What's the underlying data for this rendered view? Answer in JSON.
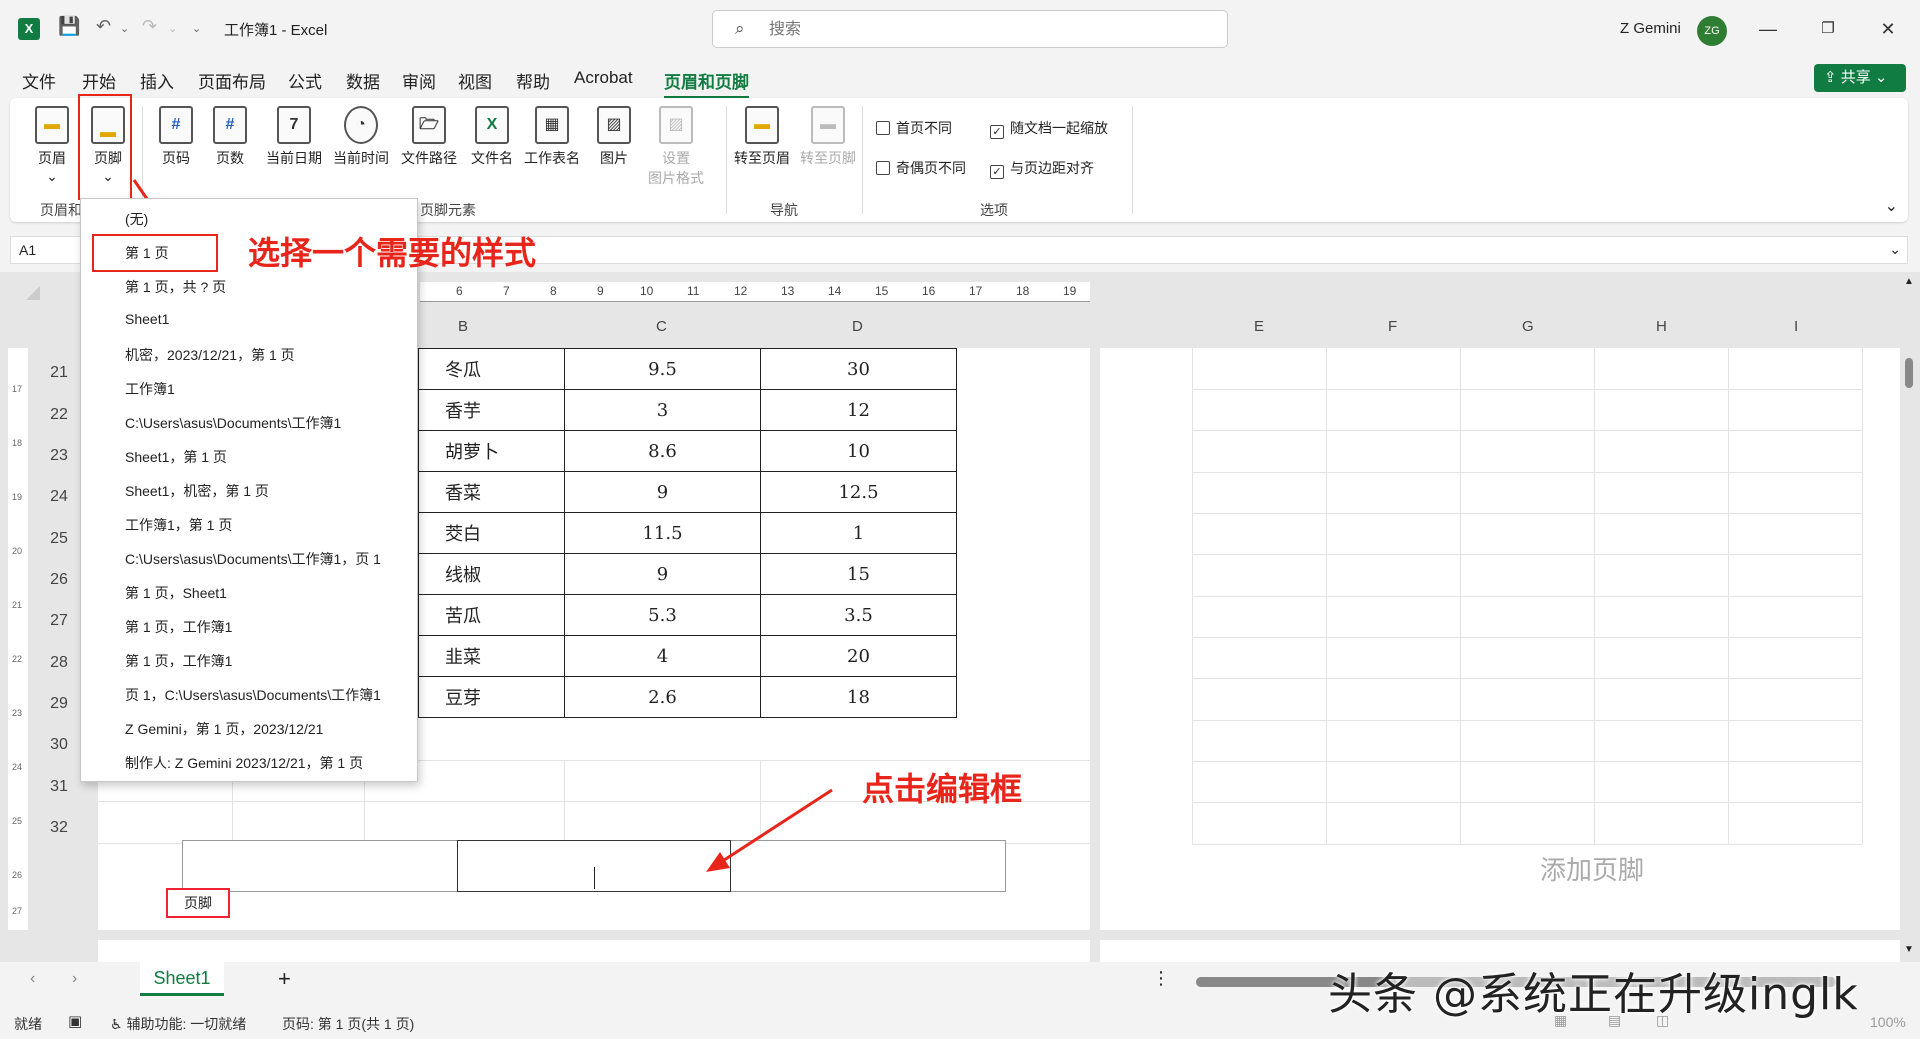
{
  "app": {
    "title": "工作簿1  -  Excel",
    "search_placeholder": "搜索",
    "user_name": "Z Gemini",
    "user_initials": "ZG",
    "share_label": "共享",
    "brand_color": "#107c41"
  },
  "menu": {
    "tabs": [
      "文件",
      "开始",
      "插入",
      "页面布局",
      "公式",
      "数据",
      "审阅",
      "视图",
      "帮助",
      "Acrobat",
      "页眉和页脚"
    ],
    "active": "页眉和页脚"
  },
  "ribbon": {
    "header_label": "页眉",
    "footer_label": "页脚",
    "elements": [
      "页码",
      "页数",
      "当前日期",
      "当前时间",
      "文件路径",
      "文件名",
      "工作表名",
      "图片"
    ],
    "format_picture_line1": "设置",
    "format_picture_line2": "图片格式",
    "goto_header": "转至页眉",
    "goto_footer": "转至页脚",
    "options": {
      "first_page_diff": "首页不同",
      "odd_even_diff": "奇偶页不同",
      "scale_with_doc": "随文档一起缩放",
      "align_margins": "与页边距对齐"
    },
    "groups": {
      "header_footer": "页眉和",
      "elements": "页脚元素",
      "navigation": "导航",
      "options": "选项"
    }
  },
  "formula_bar": {
    "name_box": "A1"
  },
  "dropdown_items": [
    "(无)",
    "第 1 页",
    "第 1 页，共 ? 页",
    "Sheet1",
    " 机密，2023/12/21，第 1 页",
    "工作簿1",
    "C:\\Users\\asus\\Documents\\工作簿1",
    "Sheet1，第 1 页",
    "Sheet1，机密，第 1 页",
    "工作簿1，第 1 页",
    "C:\\Users\\asus\\Documents\\工作簿1，页 1",
    "第 1 页，Sheet1",
    "第 1 页，工作簿1",
    "第 1 页，工作簿1",
    "页 1，C:\\Users\\asus\\Documents\\工作簿1",
    "Z Gemini，第 1 页，2023/12/21",
    "制作人: Z Gemini 2023/12/21，第 1 页"
  ],
  "annotations": {
    "choose_style": "选择一个需要的样式",
    "click_edit": "点击编辑框"
  },
  "sheet": {
    "col_headers": [
      "B",
      "C",
      "D",
      "E",
      "F",
      "G",
      "H",
      "I"
    ],
    "row_numbers": [
      "21",
      "22",
      "23",
      "24",
      "25",
      "26",
      "27",
      "28",
      "29",
      "30",
      "31",
      "32"
    ],
    "ruler_ticks": [
      "6",
      "7",
      "8",
      "9",
      "10",
      "11",
      "12",
      "13",
      "14",
      "15",
      "16",
      "17",
      "18",
      "19"
    ],
    "v_ruler_ticks": [
      "17",
      "18",
      "19",
      "20",
      "21",
      "22",
      "23",
      "24",
      "25",
      "26",
      "27"
    ],
    "rows": [
      [
        "冬瓜",
        "9.5",
        "30"
      ],
      [
        "香芋",
        "3",
        "12"
      ],
      [
        "胡萝卜",
        "8.6",
        "10"
      ],
      [
        "香菜",
        "9",
        "12.5"
      ],
      [
        "茭白",
        "11.5",
        "1"
      ],
      [
        "线椒",
        "9",
        "15"
      ],
      [
        "苦瓜",
        "5.3",
        "3.5"
      ],
      [
        "韭菜",
        "4",
        "20"
      ],
      [
        "豆芽",
        "2.6",
        "18"
      ]
    ],
    "footer_tag": "页脚",
    "add_footer": "添加页脚",
    "sheet_tab": "Sheet1",
    "add_sheet": "+"
  },
  "status": {
    "ready": "就绪",
    "accessibility": "辅助功能: 一切就绪",
    "page_info": "页码: 第 1 页(共 1 页)",
    "zoom": "100%"
  },
  "watermark": "头条 @系统正在升级inglk"
}
